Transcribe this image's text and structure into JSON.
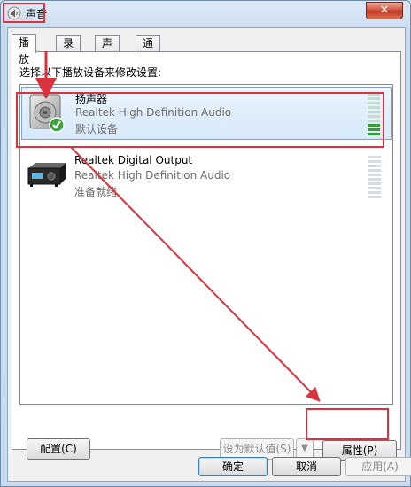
{
  "window": {
    "title": "声音",
    "close_label": "✕"
  },
  "tabs": [
    {
      "label": "播放",
      "active": true
    },
    {
      "label": "录制",
      "active": false
    },
    {
      "label": "声音",
      "active": false
    },
    {
      "label": "通信",
      "active": false
    }
  ],
  "instruction": "选择以下播放设备来修改设置:",
  "devices": [
    {
      "name": "扬声器",
      "description": "Realtek High Definition Audio",
      "status": "默认设备",
      "selected": true,
      "icon": "speaker-icon",
      "level": 0.3
    },
    {
      "name": "Realtek Digital Output",
      "description": "Realtek High Definition Audio",
      "status": "准备就绪",
      "selected": false,
      "icon": "digital-output-icon",
      "level": 0
    }
  ],
  "buttons": {
    "configure": "配置(C)",
    "set_default": "设为默认值(S)",
    "set_default_arrow": "▼",
    "properties": "属性(P)",
    "ok": "确定",
    "cancel": "取消",
    "apply": "应用(A)"
  },
  "colors": {
    "annotation_red": "#d9333f",
    "selection_bg": "#d7e9fa",
    "meter_green": "#3a9a3a"
  }
}
